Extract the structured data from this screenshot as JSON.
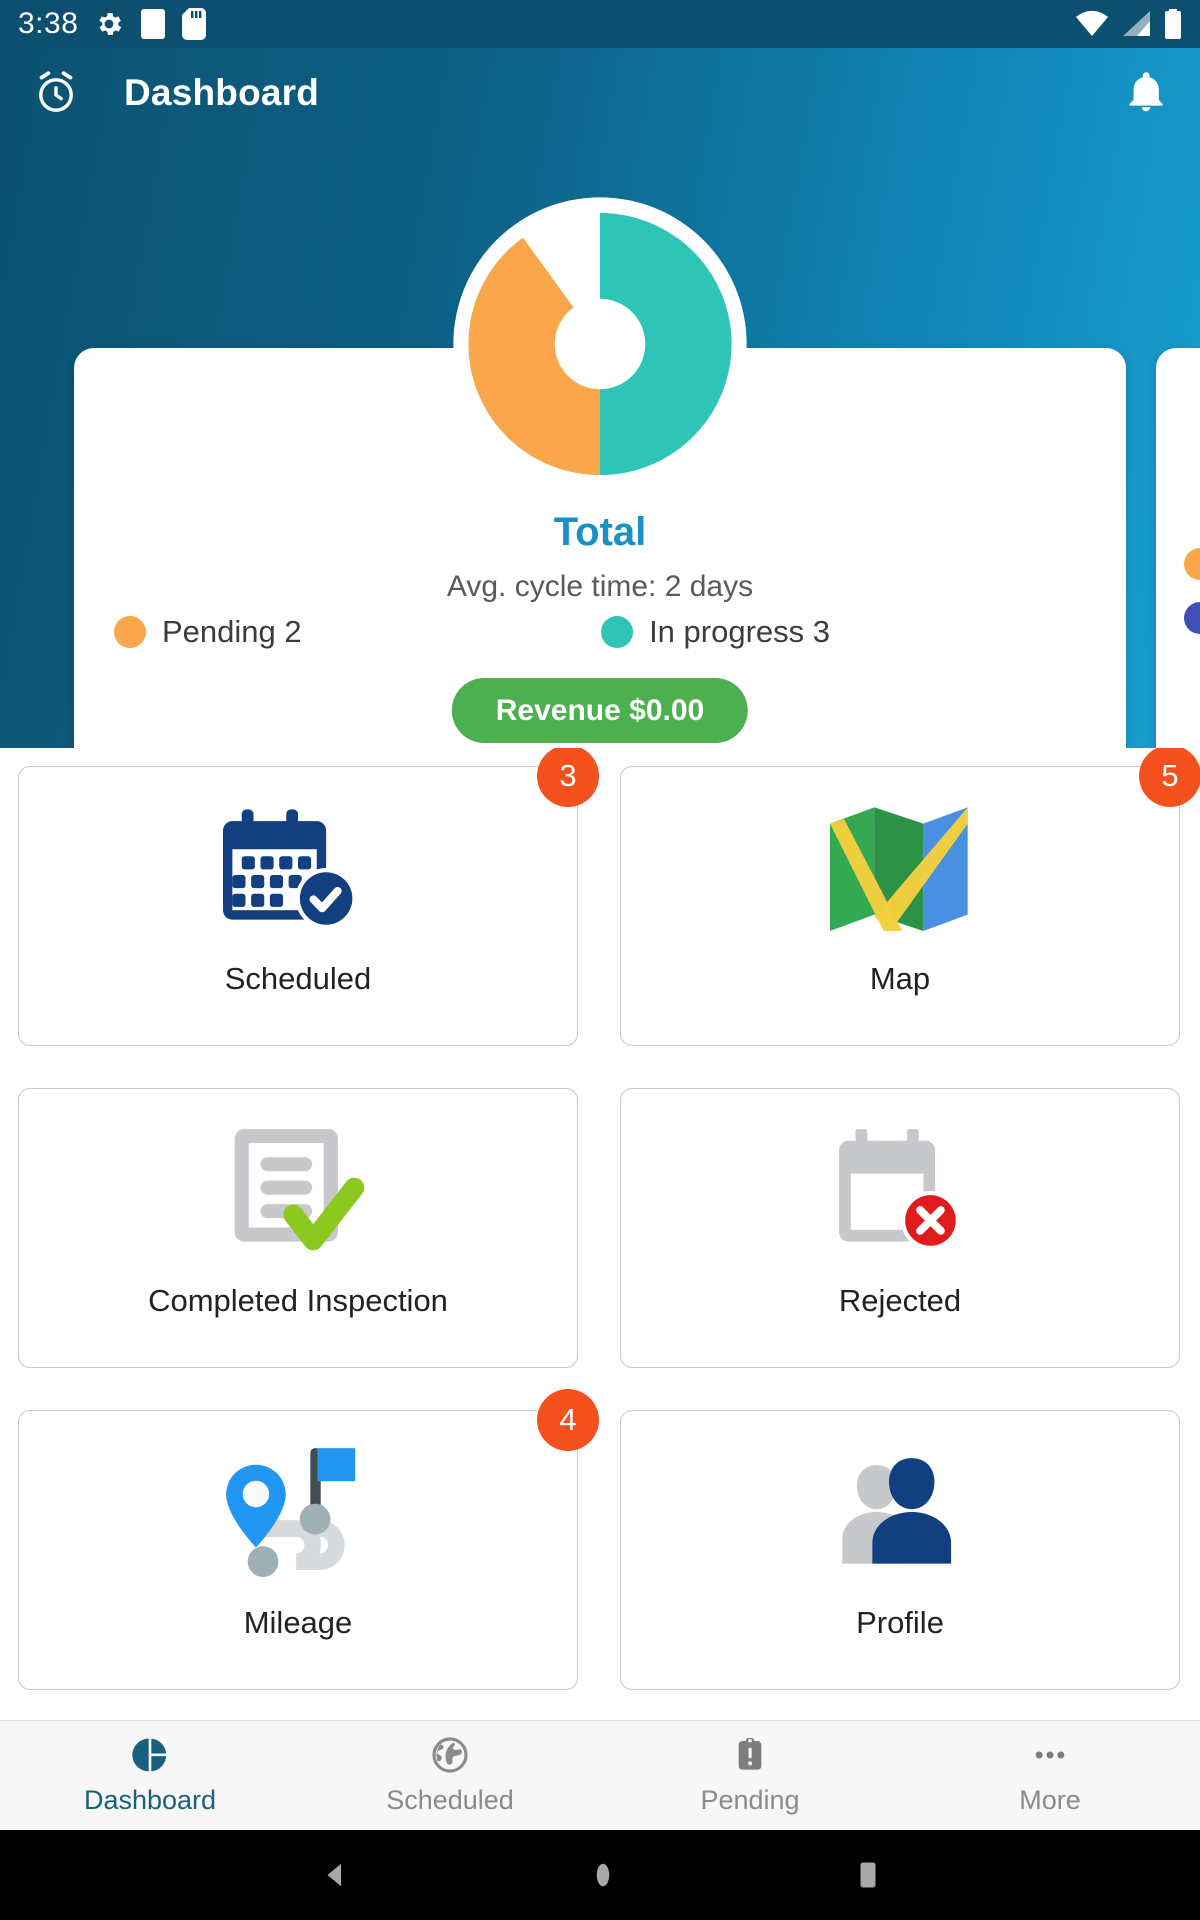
{
  "status_bar": {
    "time": "3:38",
    "icons_left": [
      "gear-icon",
      "white-square-icon",
      "sd-card-icon"
    ],
    "icons_right": [
      "wifi-icon",
      "cell-signal-icon",
      "battery-icon"
    ],
    "background": "#0d4f6e"
  },
  "header": {
    "title": "Dashboard",
    "left_icon": "alarm-clock-icon",
    "right_icon": "notification-bell-icon",
    "gradient_from": "#0b5273",
    "gradient_to": "#18a0d0"
  },
  "stat_card": {
    "total_label": "Total",
    "total_color": "#1a8fc8",
    "cycle_time": "Avg. cycle time: 2 days",
    "legend": [
      {
        "label": "Pending 2",
        "color": "#f9a74a"
      },
      {
        "label": "In progress 3",
        "color": "#2ec4b6"
      }
    ],
    "revenue_button": "Revenue $0.00",
    "revenue_color": "#4caf50"
  },
  "next_card": {
    "legend_colors": [
      "#f9a74a",
      "#3f51b5"
    ]
  },
  "chart_data": {
    "type": "pie",
    "title": "Total",
    "subtitle": "Avg. cycle time: 2 days",
    "categories": [
      "In progress",
      "Pending"
    ],
    "values": [
      3,
      2
    ],
    "colors": [
      "#2ec4b6",
      "#f9a74a"
    ],
    "total": 5,
    "donut": true,
    "legend_position": "bottom",
    "labels": [
      "In progress 3",
      "Pending 2"
    ]
  },
  "tiles": [
    {
      "label": "Scheduled",
      "icon": "calendar-check-icon",
      "badge": "3"
    },
    {
      "label": "Map",
      "icon": "folded-map-icon",
      "badge": "5"
    },
    {
      "label": "Completed Inspection",
      "icon": "document-check-icon",
      "badge": ""
    },
    {
      "label": "Rejected",
      "icon": "calendar-x-icon",
      "badge": ""
    },
    {
      "label": "Mileage",
      "icon": "route-pin-flag-icon",
      "badge": "4"
    },
    {
      "label": "Profile",
      "icon": "people-icon",
      "badge": ""
    }
  ],
  "bottom_nav": {
    "items": [
      {
        "label": "Dashboard",
        "icon": "pie-chart-icon",
        "active": true
      },
      {
        "label": "Scheduled",
        "icon": "globe-icon",
        "active": false
      },
      {
        "label": "Pending",
        "icon": "clipboard-alert-icon",
        "active": false
      },
      {
        "label": "More",
        "icon": "ellipsis-icon",
        "active": false
      }
    ],
    "active_color": "#19607f",
    "inactive_color": "#8a8a8a"
  },
  "android_nav": {
    "buttons": [
      "back-button",
      "home-button",
      "recents-button"
    ]
  }
}
